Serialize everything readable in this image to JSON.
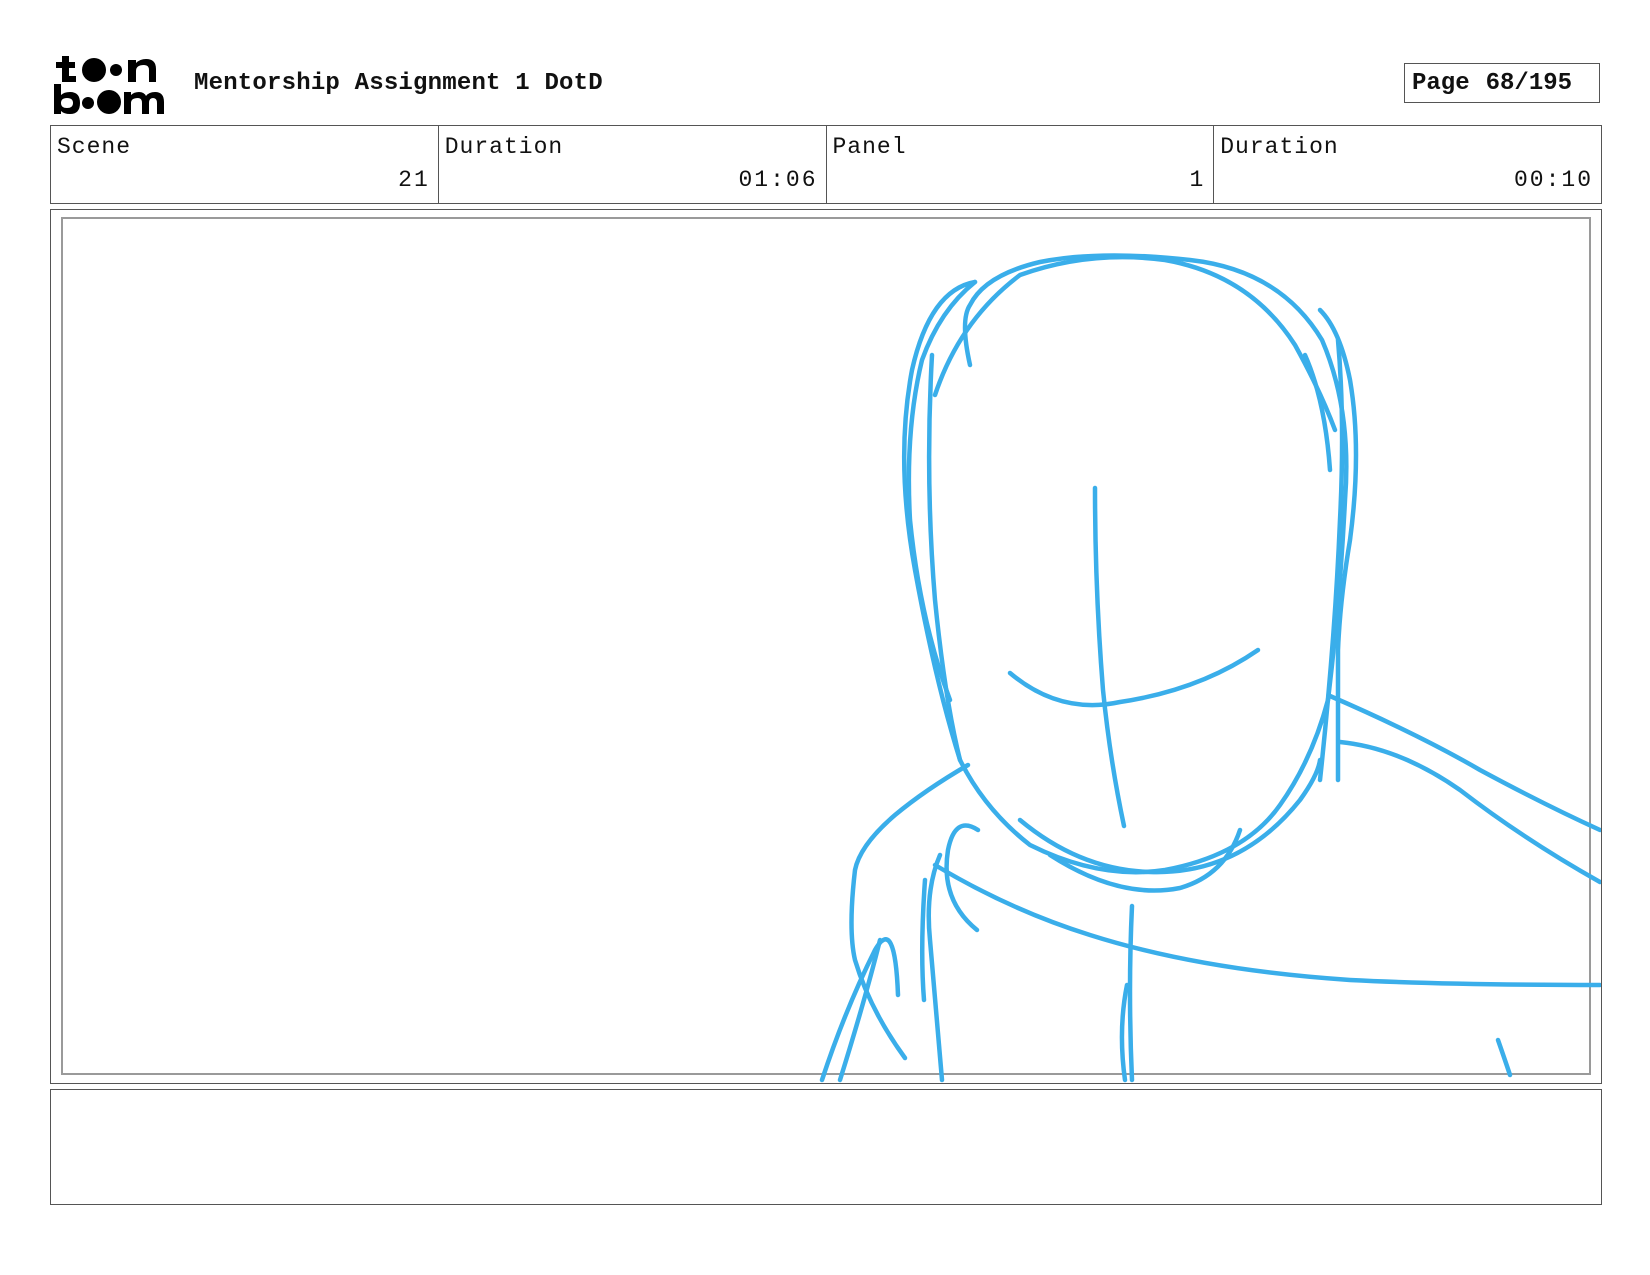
{
  "header": {
    "logo_text_top": "toon",
    "logo_text_bottom": "boom",
    "title": "Mentorship Assignment 1 DotD",
    "page_label": "Page",
    "page_number": "68/195"
  },
  "info": {
    "scene_label": "Scene",
    "scene_value": "21",
    "scene_duration_label": "Duration",
    "scene_duration_value": "01:06",
    "panel_label": "Panel",
    "panel_value": "1",
    "panel_duration_label": "Duration",
    "panel_duration_value": "00:10"
  },
  "notes": {
    "text": ""
  },
  "colors": {
    "sketch_stroke": "#3aaeea",
    "border": "#555555"
  },
  "icons": {
    "logo": "toon-boom-logo"
  }
}
